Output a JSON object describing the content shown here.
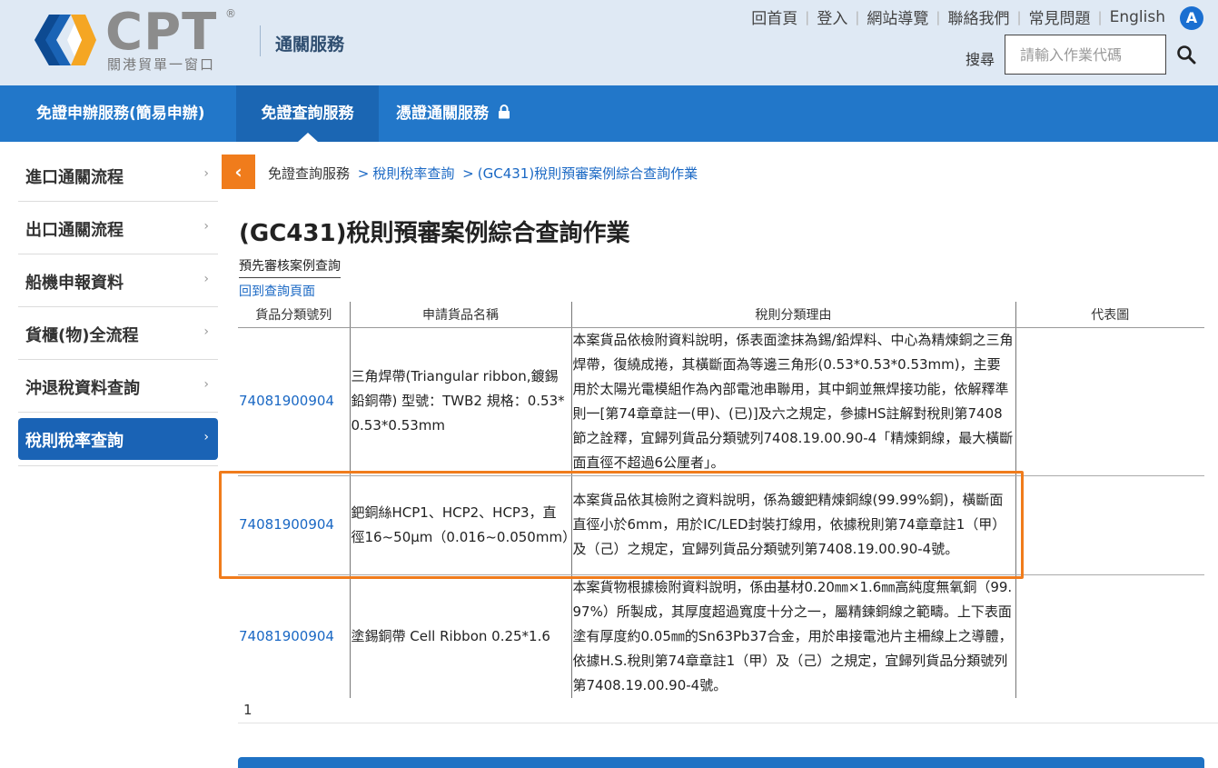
{
  "brand": {
    "logo_text": "CPT",
    "logo_reg": "®",
    "logo_sub": "關港貿單一窗口",
    "site_title": "通關服務"
  },
  "topnav": {
    "links": [
      "回首頁",
      "登入",
      "網站導覽",
      "聯絡我們",
      "常見問題",
      "English"
    ],
    "accessibility_badge": "A"
  },
  "search": {
    "label": "搜尋",
    "placeholder": "請輸入作業代碼"
  },
  "mainnav": {
    "tabs": [
      {
        "label": "免證申辦服務(簡易申辦)"
      },
      {
        "label": "免證查詢服務"
      },
      {
        "label": "憑證通關服務"
      }
    ]
  },
  "sidebar": {
    "items": [
      {
        "label": "進口通關流程"
      },
      {
        "label": "出口通關流程"
      },
      {
        "label": "船機申報資料"
      },
      {
        "label": "貨櫃(物)全流程"
      },
      {
        "label": "沖退稅資料查詢"
      },
      {
        "label": "稅則稅率查詢"
      }
    ],
    "chevron": "›"
  },
  "back_button": "‹",
  "breadcrumb": {
    "items": [
      "免證查詢服務",
      "稅則稅率查詢",
      "(GC431)稅則預審案例綜合查詢作業"
    ],
    "separator": ">"
  },
  "page": {
    "title": "(GC431)稅則預審案例綜合查詢作業",
    "sub_tab": "預先審核案例查詢",
    "back_link": "回到查詢頁面"
  },
  "table": {
    "headers": [
      "貨品分類號列",
      "申請貨品名稱",
      "稅則分類理由",
      "代表圖"
    ],
    "rows": [
      {
        "code": "74081900904",
        "name": "三角焊帶(Triangular ribbon,鍍錫鉛銅帶) 型號：TWB2 規格：0.53*0.53*0.53mm",
        "reason": "本案貨品依檢附資料說明，係表面塗抹為錫/鉛焊料、中心為精煉銅之三角焊帶，復繞成捲，其橫斷面為等邊三角形(0.53*0.53*0.53mm)，主要用於太陽光電模組作為內部電池串聯用，其中銅並無焊接功能，依解釋準則一[第74章章註一(甲)、(已)]及六之規定，參據HS註解對稅則第7408節之詮釋，宜歸列貨品分類號列7408.19.00.90-4「精煉銅線，最大橫斷面直徑不超過6公厘者」。",
        "image": ""
      },
      {
        "code": "74081900904",
        "name": "鈀銅絲HCP1、HCP2、HCP3，直徑16~50µm（0.016~0.050mm）",
        "reason": "本案貨品依其檢附之資料說明，係為鍍鈀精煉銅線(99.99%銅)，橫斷面直徑小於6mm，用於IC/LED封裝打線用，依據稅則第74章章註1（甲）及（己）之規定，宜歸列貨品分類號列第7408.19.00.90-4號。",
        "image": ""
      },
      {
        "code": "74081900904",
        "name": "塗錫銅帶 Cell Ribbon 0.25*1.6",
        "reason": "本案貨物根據檢附資料說明，係由基材0.20㎜×1.6㎜高純度無氧銅（99.97%）所製成，其厚度超過寬度十分之一，屬精鍊銅線之範疇。上下表面塗有厚度約0.05㎜的Sn63Pb37合金，用於串接電池片主柵線上之導體，依據H.S.稅則第74章章註1（甲）及（己）之規定，宜歸列貨品分類號列第7408.19.00.90-4號。",
        "image": ""
      }
    ]
  },
  "pager": {
    "current": "1"
  },
  "colors": {
    "header_bg": "#dfe9f4",
    "nav_blue": "#2277c9",
    "active_blue": "#1a63b5",
    "accent_orange": "#f07c1c",
    "link_blue": "#1a68c4"
  }
}
